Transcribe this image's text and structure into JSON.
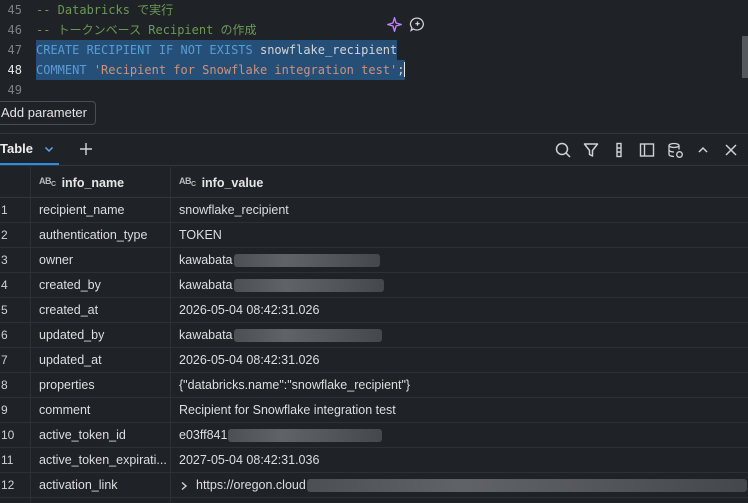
{
  "editor": {
    "lines": [
      {
        "number": "45",
        "comment": "-- Databricks で実行"
      },
      {
        "number": "46",
        "comment": "-- トークンベース Recipient の作成"
      },
      {
        "number": "47",
        "kw": "CREATE RECIPIENT IF NOT EXISTS",
        "ident": "snowflake_recipient"
      },
      {
        "number": "48",
        "kw": "COMMENT",
        "str": "'Recipient for Snowflake integration test'",
        "end": ";"
      },
      {
        "number": "49"
      }
    ]
  },
  "add_parameter_label": "Add parameter",
  "results": {
    "tab_label": "Table",
    "columns": [
      {
        "type_badge": "ABC",
        "label": "info_name"
      },
      {
        "type_badge": "ABC",
        "label": "info_value"
      }
    ],
    "rows": [
      {
        "n": "1",
        "name": "recipient_name",
        "value": "snowflake_recipient"
      },
      {
        "n": "2",
        "name": "authentication_type",
        "value": "TOKEN"
      },
      {
        "n": "3",
        "name": "owner",
        "value": "kawabata"
      },
      {
        "n": "4",
        "name": "created_by",
        "value": "kawabata"
      },
      {
        "n": "5",
        "name": "created_at",
        "value": "2026-05-04 08:42:31.026"
      },
      {
        "n": "6",
        "name": "updated_by",
        "value": "kawabata"
      },
      {
        "n": "7",
        "name": "updated_at",
        "value": "2026-05-04 08:42:31.026"
      },
      {
        "n": "8",
        "name": "properties",
        "value": "{\"databricks.name\":\"snowflake_recipient\"}"
      },
      {
        "n": "9",
        "name": "comment",
        "value": "Recipient for Snowflake integration test"
      },
      {
        "n": "10",
        "name": "active_token_id",
        "value": "e03ff841"
      },
      {
        "n": "11",
        "name": "active_token_expirati...",
        "value": "2027-05-04 08:42:31.036"
      },
      {
        "n": "12",
        "name": "activation_link",
        "value": "https://oregon.cloud"
      }
    ]
  },
  "colors": {
    "background": "#1f2226",
    "selection": "#264f78",
    "keyword": "#569cd6",
    "comment": "#6a9955",
    "string": "#ce9178",
    "tab_accent": "#2b8ce6"
  }
}
